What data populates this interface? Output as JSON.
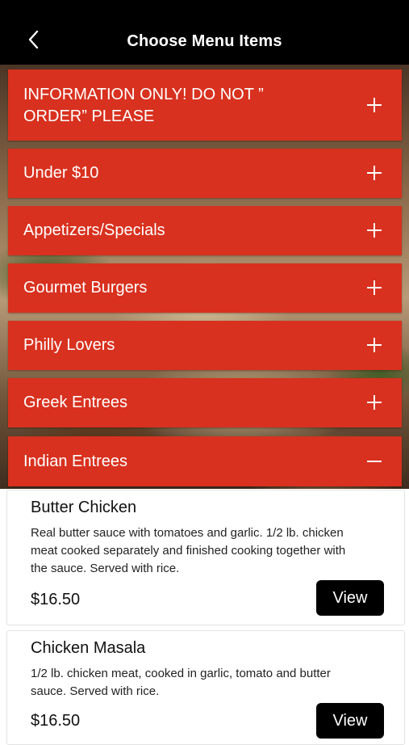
{
  "header": {
    "title": "Choose Menu Items"
  },
  "categories": [
    {
      "label": "INFORMATION ONLY!  DO NOT ” ORDER” PLEASE",
      "expanded": false
    },
    {
      "label": "Under $10",
      "expanded": false
    },
    {
      "label": "Appetizers/Specials",
      "expanded": false
    },
    {
      "label": "Gourmet Burgers",
      "expanded": false
    },
    {
      "label": "Philly Lovers",
      "expanded": false
    },
    {
      "label": "Greek Entrees",
      "expanded": false
    },
    {
      "label": "Indian Entrees",
      "expanded": true
    }
  ],
  "items": [
    {
      "name": "Butter Chicken",
      "description": "Real butter sauce with tomatoes and garlic.  1/2 lb. chicken meat cooked separately and finished cooking together with the sauce. Served with rice.",
      "price": "$16.50",
      "button": "View"
    },
    {
      "name": "Chicken Masala",
      "description": "1/2 lb. chicken meat, cooked in garlic, tomato and butter sauce. Served with rice.",
      "price": "$16.50",
      "button": "View"
    }
  ],
  "colors": {
    "accent": "#d8311f",
    "header": "#000000",
    "button": "#000000"
  }
}
